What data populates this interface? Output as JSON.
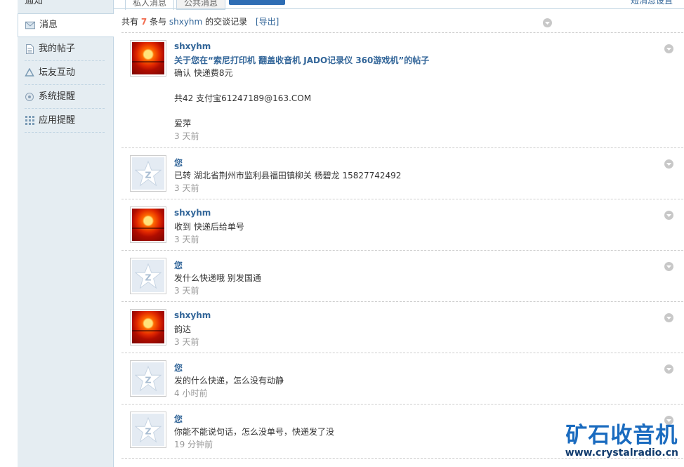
{
  "sidebar": {
    "top_label": "通知",
    "items": [
      {
        "label": "消息",
        "icon": "mail-icon"
      },
      {
        "label": "我的帖子",
        "icon": "document-icon"
      },
      {
        "label": "坛友互动",
        "icon": "recycle-icon"
      },
      {
        "label": "系统提醒",
        "icon": "system-gear-icon"
      },
      {
        "label": "应用提醒",
        "icon": "app-grid-icon"
      }
    ]
  },
  "tabs": [
    {
      "label": "私人消息"
    },
    {
      "label": "公共消息"
    }
  ],
  "top_right_link": "短消息设置",
  "summary": {
    "prefix": "共有",
    "count": "7",
    "middle": "条与",
    "user": "shxyhm",
    "suffix": "的交谈记录",
    "export": "[导出]"
  },
  "messages": [
    {
      "sender": "shxyhm",
      "avatar": "sunset-avatar",
      "lines": [
        "关于您在“索尼打印机  翻盖收音机 JADO记录仪  360游戏机”的帖子",
        "确认    快递费8元",
        "",
        "共42    支付宝61247189@163.COM",
        "",
        "爱萍"
      ],
      "time": "3 天前"
    },
    {
      "sender": "您",
      "avatar": "default-avatar",
      "lines": [
        "已转    湖北省荆州市监利县福田镇柳关  杨碧龙    15827742492"
      ],
      "time": "3 天前"
    },
    {
      "sender": "shxyhm",
      "avatar": "sunset-avatar",
      "lines": [
        "收到  快递后给单号"
      ],
      "time": "3 天前"
    },
    {
      "sender": "您",
      "avatar": "default-avatar",
      "lines": [
        "发什么快递哦  别发国通"
      ],
      "time": "3 天前"
    },
    {
      "sender": "shxyhm",
      "avatar": "sunset-avatar",
      "lines": [
        "韵达"
      ],
      "time": "3 天前"
    },
    {
      "sender": "您",
      "avatar": "default-avatar",
      "lines": [
        "发的什么快递，怎么没有动静"
      ],
      "time": "4 小时前"
    },
    {
      "sender": "您",
      "avatar": "default-avatar",
      "lines": [
        "你能不能说句话，怎么没单号，快递发了没"
      ],
      "time": "19 分钟前"
    }
  ],
  "watermark": {
    "title": "矿石收音机",
    "url": "www.crystalradio.cn"
  },
  "colors": {
    "link": "#336699",
    "count": "#f26c4f",
    "sidebar_bg": "#e5edf2",
    "watermark": "#1a6bbf"
  }
}
